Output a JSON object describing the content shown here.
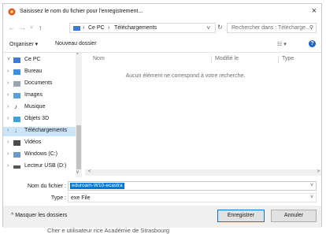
{
  "window": {
    "title": "Saisissez le nom du fichier pour l'enregistrement...",
    "close_glyph": "×"
  },
  "address": {
    "back": "←",
    "forward": "→",
    "recent": "˅",
    "up": "↑",
    "crumbs": [
      "Ce PC",
      "›",
      "Téléchargements"
    ],
    "crumb_sep_lead": "›",
    "dropdown": "˅",
    "refresh": "↻",
    "search_placeholder": "Rechercher dans : Télécharge...",
    "search_glyph": "⚲"
  },
  "toolbar": {
    "organize": "Organiser ▾",
    "new_folder": "Nouveau dossier",
    "view_glyph": "☷ ▾",
    "help_glyph": "?"
  },
  "nav": {
    "items": [
      {
        "arrow": "˅",
        "label": "Ce PC",
        "color": "#3d7bd6"
      },
      {
        "arrow": "›",
        "label": "Bureau",
        "color": "#3d8fe0"
      },
      {
        "arrow": "›",
        "label": "Documents",
        "color": "#9aa4b0"
      },
      {
        "arrow": "›",
        "label": "Images",
        "color": "#5aa0d8"
      },
      {
        "arrow": "›",
        "label": "Musique",
        "color": "#333333"
      },
      {
        "arrow": "›",
        "label": "Objets 3D",
        "color": "#3aa3d8"
      },
      {
        "arrow": "›",
        "label": "Téléchargements",
        "color": "#2a6fd0"
      },
      {
        "arrow": "›",
        "label": "Vidéos",
        "color": "#4a4a4a"
      },
      {
        "arrow": "›",
        "label": "Windows (C:)",
        "color": "#6a9bc8"
      },
      {
        "arrow": "›",
        "label": "Lecteur USB (D:)",
        "color": "#555555"
      }
    ],
    "selected_index": 6,
    "scroll_up": "^",
    "scroll_down": "v"
  },
  "content": {
    "columns": [
      "Nom",
      "Modifié le",
      "Type"
    ],
    "empty_message": "Aucun élément ne correspond à votre recherche.",
    "hscroll_left": "<",
    "hscroll_right": ">"
  },
  "filename": {
    "label": "Nom du fichier :",
    "value": "eduroam-W10-ecastra",
    "dropdown": "˅"
  },
  "filetype": {
    "label": "Type :",
    "value": "exe File",
    "dropdown": "˅"
  },
  "footer": {
    "hide_folders": "^ Masquer les dossiers",
    "save": "Enregistrer",
    "cancel": "Annuler"
  },
  "behind_text": "Cher e utilisateur rice Académie de Strasbourg"
}
